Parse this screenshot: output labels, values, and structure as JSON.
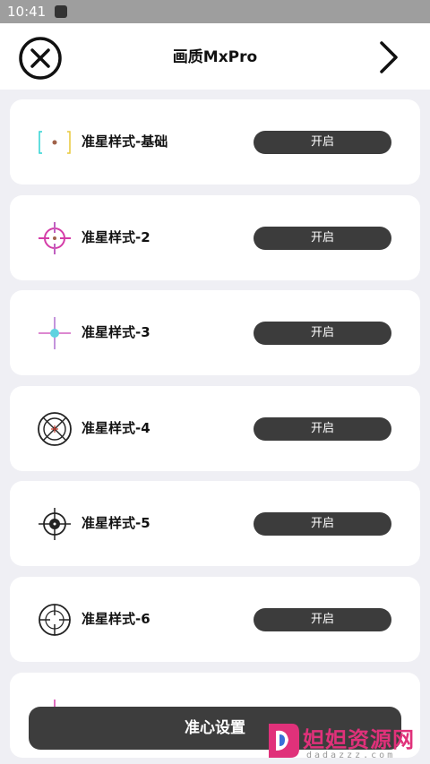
{
  "status_bar": {
    "time": "10:41"
  },
  "header": {
    "title": "画质MxPro",
    "close_icon": "close-circle-icon",
    "next_icon": "chevron-right-icon"
  },
  "items": [
    {
      "label": "准星样式-基础",
      "button": "开启",
      "icon": "crosshair-basic-icon"
    },
    {
      "label": "准星样式-2",
      "button": "开启",
      "icon": "crosshair-circle-pink-icon"
    },
    {
      "label": "准星样式-3",
      "button": "开启",
      "icon": "crosshair-cyan-dot-icon"
    },
    {
      "label": "准星样式-4",
      "button": "开启",
      "icon": "crosshair-scope-slash-icon"
    },
    {
      "label": "准星样式-5",
      "button": "开启",
      "icon": "crosshair-filled-dot-icon"
    },
    {
      "label": "准星样式-6",
      "button": "开启",
      "icon": "crosshair-scope-gap-icon"
    }
  ],
  "bottom_bar": {
    "label": "准心设置"
  },
  "watermark": {
    "name": "妲妲资源网",
    "domain": "dadazzz.com"
  },
  "colors": {
    "button_bg": "#3c3c3c",
    "page_bg": "#efeff4",
    "card_bg": "#ffffff",
    "watermark": "#e0317a"
  }
}
